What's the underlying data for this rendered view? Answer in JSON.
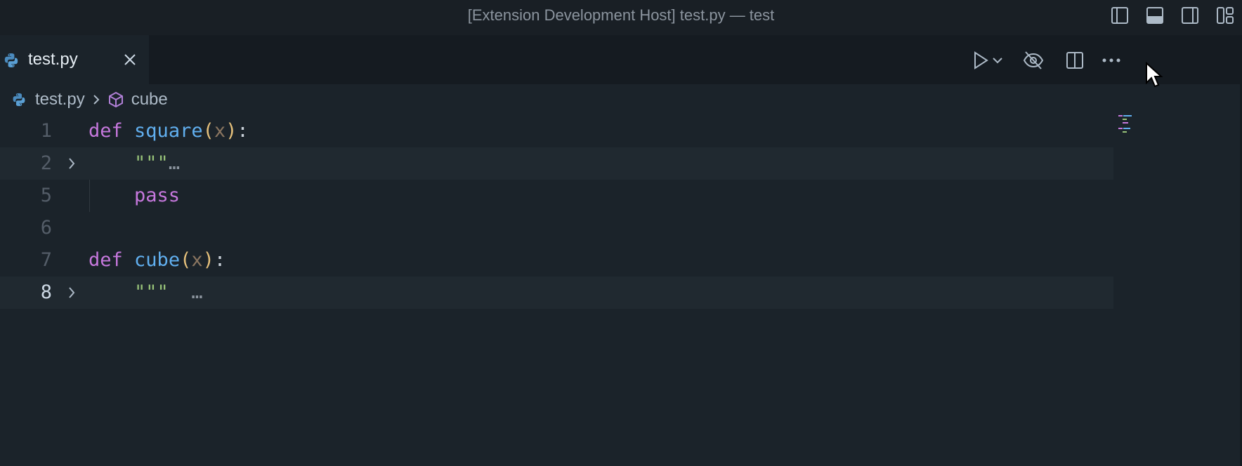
{
  "window": {
    "title": "[Extension Development Host] test.py — test"
  },
  "tabs": [
    {
      "label": "test.py",
      "language": "python"
    }
  ],
  "breadcrumb": {
    "file": "test.py",
    "symbol": "cube"
  },
  "editor": {
    "lines": [
      {
        "number": "1",
        "keyword": "def",
        "name": "square",
        "open": "(",
        "param": "x",
        "close": ")",
        "colon": ":"
      },
      {
        "number": "2",
        "string": "\"\"\"",
        "ellipsis": "…",
        "folded": true
      },
      {
        "number": "5",
        "keyword": "pass"
      },
      {
        "number": "6"
      },
      {
        "number": "7",
        "keyword": "def",
        "name": "cube",
        "open": "(",
        "param": "x",
        "close": ")",
        "colon": ":"
      },
      {
        "number": "8",
        "string": "\"\"\"",
        "ellipsis": "…",
        "folded": true,
        "current": true
      }
    ]
  },
  "colors": {
    "keyword": "#c678dd",
    "function": "#61afef",
    "paren": "#e5c07b",
    "string": "#98c379",
    "background": "#1b232a"
  },
  "icons": [
    "python-icon",
    "close-icon",
    "run-icon",
    "chevron-down-icon",
    "eye-off-icon",
    "split-editor-icon",
    "more-icon",
    "cube-icon",
    "chevron-right-icon",
    "layout-sidebar-left-icon",
    "layout-panel-icon",
    "layout-sidebar-right-icon",
    "customize-layout-icon",
    "mouse-cursor-icon"
  ]
}
